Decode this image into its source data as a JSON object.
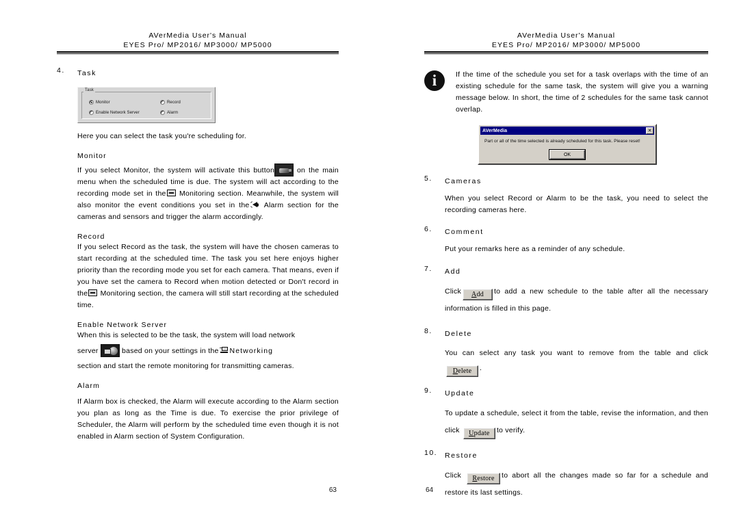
{
  "header": {
    "line1": "AVerMedia User's Manual",
    "line2": "EYES Pro/ MP2016/ MP3000/ MP5000"
  },
  "left_page": {
    "page_number": "63",
    "item4": {
      "num": "4.",
      "title": "Task",
      "caption": "Here you can select the task you're scheduling for."
    },
    "task_groupbox": {
      "legend": "Task",
      "options": [
        {
          "label": "Monitor",
          "selected": true
        },
        {
          "label": "Enable Network Server",
          "selected": false
        },
        {
          "label": "Record",
          "selected": false
        },
        {
          "label": "Alarm",
          "selected": false
        }
      ]
    },
    "monitor": {
      "heading": "Monitor",
      "text_a": "If you select Monitor, the system will activate this button",
      "text_b": "on the main menu when the scheduled time is due.  The system will act according to the recording mode set in the",
      "text_c": "Monitoring section.  Meanwhile, the system will also monitor the event conditions you set in the",
      "text_d": "Alarm section for the cameras and sensors and trigger the alarm accordingly.",
      "icon_button": "monitor-button-icon",
      "icon_monitoring": "monitoring-section-icon",
      "icon_alarm": "alarm-speaker-icon"
    },
    "record": {
      "heading": "Record",
      "text_a": "If you select Record as the task, the system will have the chosen cameras to start recording at the scheduled time.  The task you set here enjoys higher priority than the recording mode you set for each camera.  That means, even if you have set the camera to Record when motion detected or Don't record in the",
      "text_b": "Monitoring section, the camera will still start recording at the scheduled time.",
      "icon_monitoring": "monitoring-section-icon"
    },
    "network_server": {
      "heading": "Enable Network Server",
      "text_a": "When this is selected to be the task, the system will load network",
      "text_b": "server",
      "text_c": "based on your settings in the",
      "text_d": "Networking",
      "text_e": "section and start the remote monitoring for transmitting cameras.",
      "icon_server": "network-server-button-icon",
      "icon_networking": "networking-section-icon"
    },
    "alarm": {
      "heading": "Alarm",
      "text": "If Alarm box is checked, the Alarm will execute according to the Alarm section you plan as long as the Time is due. To exercise the prior privilege of Scheduler, the Alarm will perform by the scheduled time even though it is not enabled in Alarm section of System Configuration."
    }
  },
  "right_page": {
    "page_number": "64",
    "note": {
      "icon": "info-icon",
      "icon_glyph": "i",
      "text": "If the time of the schedule you set for a task overlaps with the time of an existing schedule for the same task, the system will give you a warning message below.  In short, the time of 2 schedules for the same task cannot overlap."
    },
    "dialog": {
      "title": "AVerMedia",
      "close_label": "✕",
      "close_icon": "close-icon",
      "message": "Part or all of the time selected is already scheduled for this task. Please reset!",
      "ok_label": "OK"
    },
    "item5": {
      "num": "5.",
      "title": "Cameras",
      "body": "When you select Record or Alarm to be the task, you need to select the recording cameras here."
    },
    "item6": {
      "num": "6.",
      "title": "Comment",
      "body": "Put your remarks here as a reminder of any schedule."
    },
    "item7": {
      "num": "7.",
      "title": "Add",
      "body_a": "Click",
      "button": "Add",
      "button_accel": "A",
      "button_rest": "dd",
      "body_b": "to add a new schedule to the table after all the necessary information is filled in this page."
    },
    "item8": {
      "num": "8.",
      "title": "Delete",
      "body_a": "You can select any task you want to remove from the table and click",
      "button": "Delete",
      "button_accel": "D",
      "button_rest": "elete",
      "body_b": "."
    },
    "item9": {
      "num": "9.",
      "title": "Update",
      "body_a": "To update a schedule, select it from the table, revise the information, and then click",
      "button": "Update",
      "button_accel": "U",
      "button_rest": "pdate",
      "body_b": "to verify."
    },
    "item10": {
      "num": "10.",
      "title": "Restore",
      "body_a": "Click",
      "button": "Restore",
      "button_accel": "R",
      "button_rest": "estore",
      "body_b": "to abort all the changes made so far for a schedule and restore its last settings."
    }
  }
}
